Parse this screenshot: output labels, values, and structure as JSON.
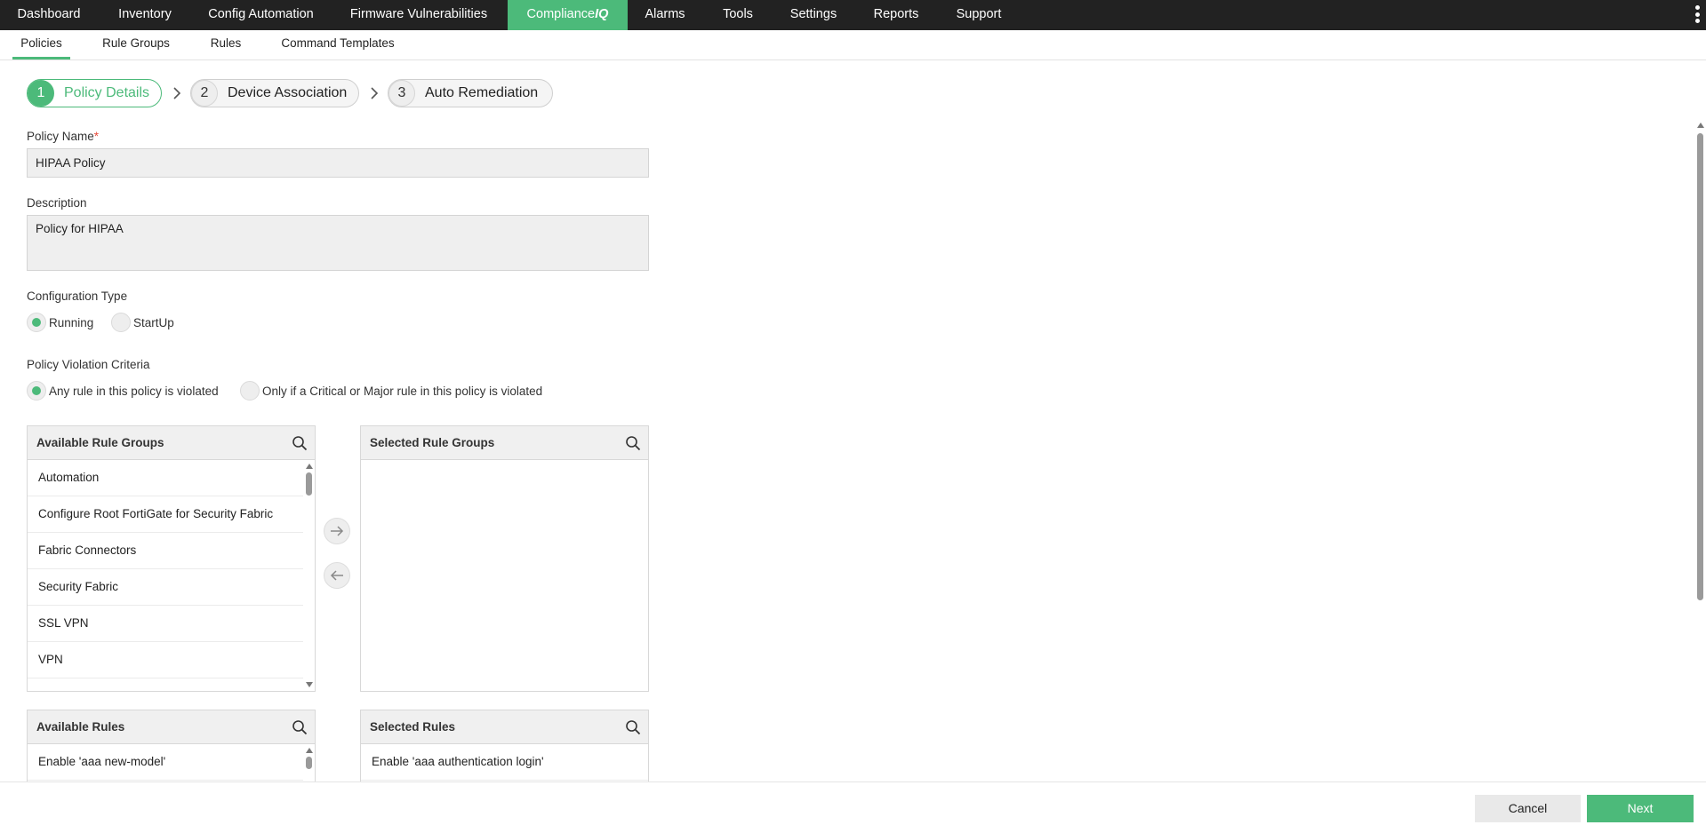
{
  "topnav": {
    "items": [
      "Dashboard",
      "Inventory",
      "Config Automation",
      "Firmware Vulnerabilities",
      "Compliance",
      "Alarms",
      "Tools",
      "Settings",
      "Reports",
      "Support"
    ],
    "active_suffix": "IQ"
  },
  "subnav": {
    "items": [
      "Policies",
      "Rule Groups",
      "Rules",
      "Command Templates"
    ]
  },
  "wizard": {
    "steps": [
      {
        "num": "1",
        "label": "Policy Details"
      },
      {
        "num": "2",
        "label": "Device Association"
      },
      {
        "num": "3",
        "label": "Auto Remediation"
      }
    ]
  },
  "form": {
    "policy_name_label": "Policy Name",
    "required_mark": "*",
    "policy_name_value": "HIPAA Policy",
    "description_label": "Description",
    "description_value": "Policy for HIPAA",
    "config_type_label": "Configuration Type",
    "config_type_options": [
      "Running",
      "StartUp"
    ],
    "violation_label": "Policy Violation Criteria",
    "violation_options": [
      "Any rule in this policy is violated",
      "Only if a Critical or Major rule in this policy is violated"
    ]
  },
  "rule_groups": {
    "available_title": "Available Rule Groups",
    "selected_title": "Selected Rule Groups",
    "available_items": [
      "Automation",
      "Configure Root FortiGate for Security Fabric",
      "Fabric Connectors",
      "Security Fabric",
      "SSL VPN",
      "VPN"
    ]
  },
  "rules": {
    "available_title": "Available Rules",
    "selected_title": "Selected Rules",
    "available_items": [
      "Enable 'aaa new-model'"
    ],
    "selected_items": [
      "Enable 'aaa authentication login'"
    ]
  },
  "footer": {
    "cancel_label": "Cancel",
    "next_label": "Next"
  },
  "colors": {
    "accent": "#4cba7a",
    "topbar": "#222222"
  }
}
